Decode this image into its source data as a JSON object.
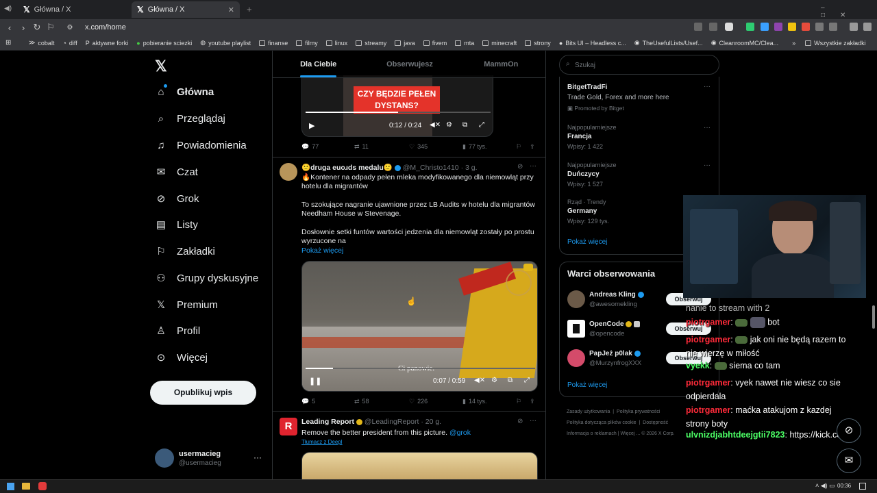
{
  "browser": {
    "tabs": [
      {
        "title": "Główna / X"
      },
      {
        "title": "Główna / X"
      }
    ],
    "url": "x.com/home",
    "bookmarks": [
      "cobalt",
      "diff",
      "aktywne forki",
      "pobieranie sciezki",
      "youtube playlist",
      "finanse",
      "filmy",
      "linux",
      "streamy",
      "java",
      "fivem",
      "mta",
      "minecraft",
      "strony",
      "Bits UI – Headless c...",
      "TheUsefulLists/Usef...",
      "CleanroomMC/Clea..."
    ],
    "bookmarks_all": "Wszystkie zakładki"
  },
  "sidebar": {
    "items": [
      {
        "label": "Główna",
        "icon": "home-icon"
      },
      {
        "label": "Przeglądaj",
        "icon": "search-icon"
      },
      {
        "label": "Powiadomienia",
        "icon": "bell-icon"
      },
      {
        "label": "Czat",
        "icon": "mail-icon"
      },
      {
        "label": "Grok",
        "icon": "grok-icon"
      },
      {
        "label": "Listy",
        "icon": "list-icon"
      },
      {
        "label": "Zakładki",
        "icon": "bookmark-icon"
      },
      {
        "label": "Grupy dyskusyjne",
        "icon": "people-icon"
      },
      {
        "label": "Premium",
        "icon": "x-icon"
      },
      {
        "label": "Profil",
        "icon": "person-icon"
      },
      {
        "label": "Więcej",
        "icon": "more-icon"
      }
    ],
    "post_button": "Opublikuj wpis",
    "user": {
      "name": "usermacieg",
      "handle": "@usermacieg"
    }
  },
  "feed": {
    "tabs": [
      "Dla Ciebie",
      "Obserwujesz",
      "MammOn"
    ],
    "post0": {
      "overlay_text": "CZY BĘDZIE PEŁEN DYSTANS?",
      "time": "0:12 / 0:24",
      "replies": "77",
      "reposts": "11",
      "likes": "345",
      "views": "77 tys."
    },
    "post1": {
      "name": "🙂druga euoɹds medalu🙂",
      "handle": "@M_Christo1410",
      "time": "3 g.",
      "text1": "🔥Kontener na odpady pełen mleka modyfikowanego dla niemowląt przy hotelu dla migrantów",
      "text2": "To szokujące nagranie ujawnione przez LB Audits w hotelu dla migrantów Needham House w Stevenage.",
      "text3": "Dosłownie setki funtów wartości jedzenia dla niemowląt zostały po prostu wyrzucone na",
      "show_more": "Pokaż więcej",
      "subtitle": "Ci panowie.",
      "vtime": "0:07 / 0:59",
      "replies": "5",
      "reposts": "58",
      "likes": "226",
      "views": "14 tys."
    },
    "post2": {
      "name": "Leading Report",
      "handle": "@LeadingReport",
      "time": "20 g.",
      "text": "Remove the better president from this picture.",
      "mention": "@grok",
      "translate": "Tłumacz z Deepl"
    }
  },
  "right": {
    "search_placeholder": "Szukaj",
    "trends": [
      {
        "cat": "",
        "title": "BitgetTradFi",
        "sub": "Trade Gold, Forex and more here",
        "extra": "Promoted by Bitget"
      },
      {
        "cat": "Najpopularniejsze",
        "title": "Francja",
        "sub": "Wpisy: 1 422"
      },
      {
        "cat": "Najpopularniejsze",
        "title": "Duńczycy",
        "sub": "Wpisy: 1 527"
      },
      {
        "cat": "Rząd · Trendy",
        "title": "Germany",
        "sub": "Wpisy: 129 tys."
      }
    ],
    "show_more": "Pokaż więcej",
    "wtf_title": "Warci obserwowania",
    "who": [
      {
        "name": "Andreas Kling",
        "handle": "@awesomekling"
      },
      {
        "name": "OpenCode",
        "handle": "@opencode"
      },
      {
        "name": "PapJeż p0lak",
        "handle": "@MurzynfrogXXX"
      }
    ],
    "follow_label": "Obserwuj",
    "show_more2": "Pokaż więcej",
    "footer": [
      "Zasady użytkowania",
      "Polityka prywatności",
      "Polityka dotycząca plików cookie",
      "Dostępność",
      "Informacja o reklamach",
      "Więcej ...",
      "© 2026 X Corp."
    ]
  },
  "chat": [
    {
      "user": "",
      "text": "nanie to stream with 2"
    },
    {
      "user": "piotrgamer",
      "text": "bot"
    },
    {
      "user": "piotrgamer",
      "text": "jak oni nie będą razem to nie wierzę w miłość"
    },
    {
      "user": "vyekk",
      "text": "siema co tam"
    },
    {
      "user": "piotrgamer",
      "text": "vyek nawet nie wiesz co sie odpierdala"
    },
    {
      "user": "piotrgamer",
      "text": "maćka atakujom z kazdej strony boty"
    },
    {
      "user": "ulvnizdjabhtdeejgtii7823",
      "text": "https://kick.com/"
    }
  ],
  "clock": "00:36"
}
